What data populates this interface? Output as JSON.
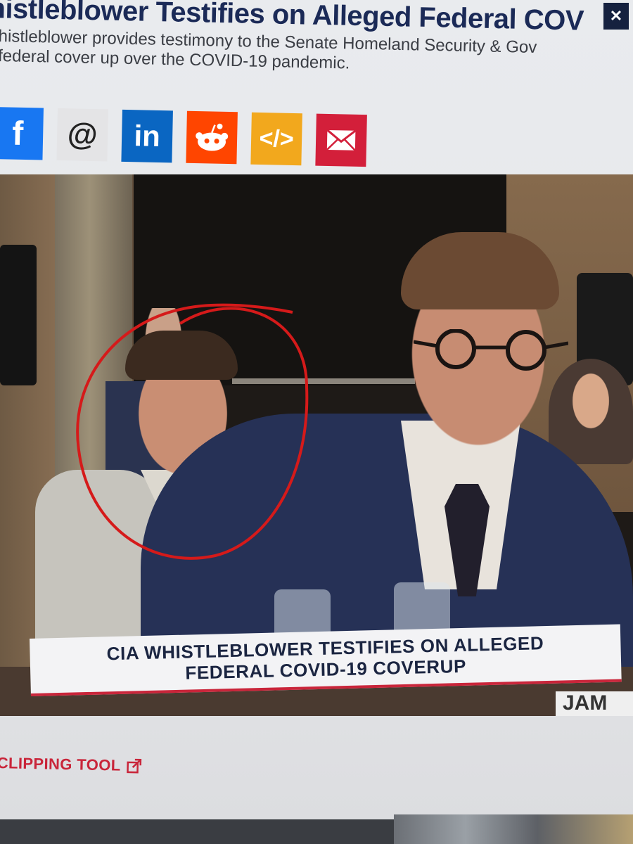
{
  "article": {
    "title": "histleblower Testifies on Alleged Federal COV",
    "subtitle_line1": "histleblower provides testimony to the Senate Homeland Security & Gov",
    "subtitle_line2": "federal cover up over the COVID-19 pandemic.",
    "close_label": "✕"
  },
  "share": {
    "buttons": [
      {
        "name": "facebook-share-button",
        "icon": "facebook-icon",
        "color": "#1877f2"
      },
      {
        "name": "threads-share-button",
        "icon": "threads-icon",
        "color": "#e4e4e6"
      },
      {
        "name": "linkedin-share-button",
        "icon": "linkedin-icon",
        "color": "#0a66c2"
      },
      {
        "name": "reddit-share-button",
        "icon": "reddit-icon",
        "color": "#ff4500"
      },
      {
        "name": "embed-share-button",
        "icon": "embed-code-icon",
        "color": "#f2a81d"
      },
      {
        "name": "email-share-button",
        "icon": "mail-icon",
        "color": "#d31f3a"
      }
    ],
    "facebook_glyph": "f",
    "threads_glyph": "@",
    "linkedin_glyph": "in",
    "embed_glyph": "</>"
  },
  "video": {
    "lower_third_line1": "CIA WHISTLEBLOWER TESTIFIES ON ALLEGED",
    "lower_third_line2": "FEDERAL COVID-19 COVERUP",
    "nameplate": "JAM"
  },
  "footer": {
    "clipping_tool_label": "CLIPPING TOOL"
  },
  "colors": {
    "headline": "#1b2a57",
    "accent_red": "#c9253a"
  }
}
